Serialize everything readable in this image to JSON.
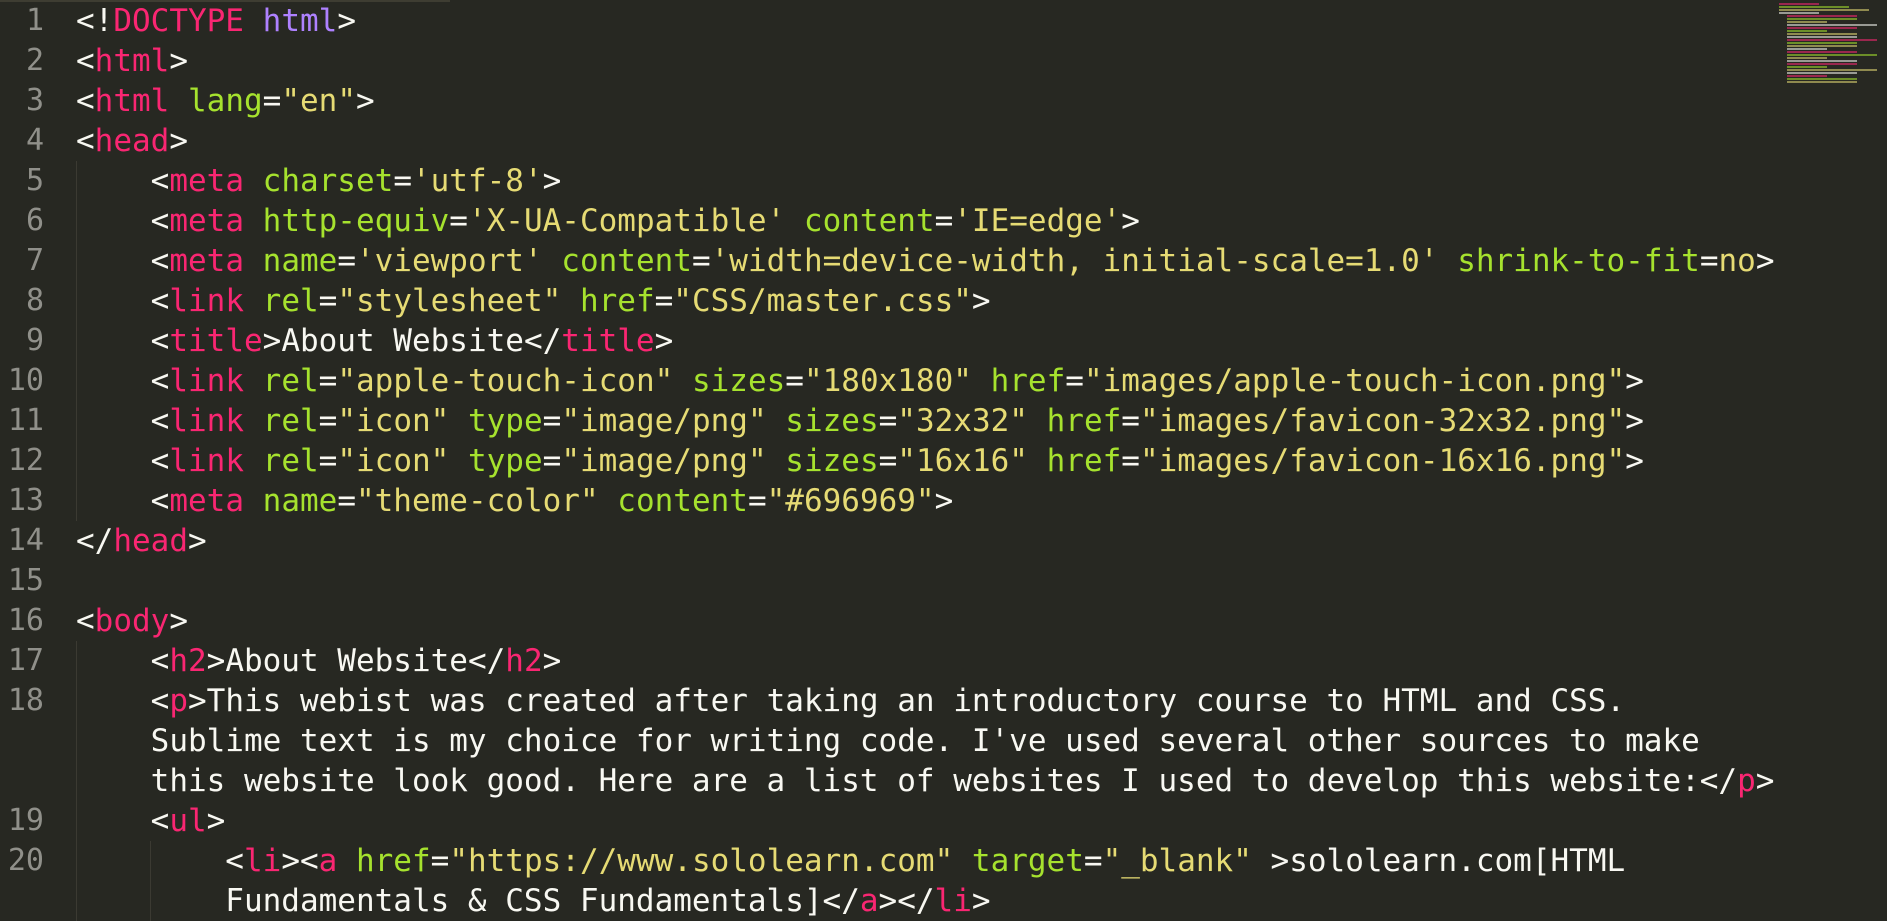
{
  "editor": {
    "theme_colors": {
      "background": "#272822",
      "tag": "#f92672",
      "attribute": "#a6e22e",
      "string": "#e6db74",
      "doctype": "#ae81ff",
      "text": "#f8f8f2",
      "line_number": "#90908a"
    },
    "line_numbers": [
      "1",
      "2",
      "3",
      "4",
      "5",
      "6",
      "7",
      "8",
      "9",
      "10",
      "11",
      "12",
      "13",
      "14",
      "15",
      "16",
      "17",
      "18",
      "19",
      "20"
    ],
    "lines": [
      {
        "segments": [
          {
            "t": "<!",
            "c": "pl"
          },
          {
            "t": "DOCTYPE",
            "c": "tg"
          },
          {
            "t": " ",
            "c": "pl"
          },
          {
            "t": "html",
            "c": "dt"
          },
          {
            "t": ">",
            "c": "pl"
          }
        ]
      },
      {
        "segments": [
          {
            "t": "<",
            "c": "pl"
          },
          {
            "t": "html",
            "c": "tg"
          },
          {
            "t": ">",
            "c": "pl"
          }
        ]
      },
      {
        "segments": [
          {
            "t": "<",
            "c": "pl"
          },
          {
            "t": "html",
            "c": "tg"
          },
          {
            "t": " ",
            "c": "pl"
          },
          {
            "t": "lang",
            "c": "an"
          },
          {
            "t": "=",
            "c": "pl"
          },
          {
            "t": "\"en\"",
            "c": "sv"
          },
          {
            "t": ">",
            "c": "pl"
          }
        ]
      },
      {
        "segments": [
          {
            "t": "<",
            "c": "pl"
          },
          {
            "t": "head",
            "c": "tg"
          },
          {
            "t": ">",
            "c": "pl"
          }
        ]
      },
      {
        "segments": [
          {
            "t": "    <",
            "c": "pl"
          },
          {
            "t": "meta",
            "c": "tg"
          },
          {
            "t": " ",
            "c": "pl"
          },
          {
            "t": "charset",
            "c": "an"
          },
          {
            "t": "=",
            "c": "pl"
          },
          {
            "t": "'utf-8'",
            "c": "sv"
          },
          {
            "t": ">",
            "c": "pl"
          }
        ]
      },
      {
        "segments": [
          {
            "t": "    <",
            "c": "pl"
          },
          {
            "t": "meta",
            "c": "tg"
          },
          {
            "t": " ",
            "c": "pl"
          },
          {
            "t": "http-equiv",
            "c": "an"
          },
          {
            "t": "=",
            "c": "pl"
          },
          {
            "t": "'X-UA-Compatible'",
            "c": "sv"
          },
          {
            "t": " ",
            "c": "pl"
          },
          {
            "t": "content",
            "c": "an"
          },
          {
            "t": "=",
            "c": "pl"
          },
          {
            "t": "'IE=edge'",
            "c": "sv"
          },
          {
            "t": ">",
            "c": "pl"
          }
        ]
      },
      {
        "segments": [
          {
            "t": "    <",
            "c": "pl"
          },
          {
            "t": "meta",
            "c": "tg"
          },
          {
            "t": " ",
            "c": "pl"
          },
          {
            "t": "name",
            "c": "an"
          },
          {
            "t": "=",
            "c": "pl"
          },
          {
            "t": "'viewport'",
            "c": "sv"
          },
          {
            "t": " ",
            "c": "pl"
          },
          {
            "t": "content",
            "c": "an"
          },
          {
            "t": "=",
            "c": "pl"
          },
          {
            "t": "'width=device-width, initial-scale=1.0'",
            "c": "sv"
          },
          {
            "t": " ",
            "c": "pl"
          },
          {
            "t": "shrink-to-fit",
            "c": "an"
          },
          {
            "t": "=",
            "c": "pl"
          },
          {
            "t": "no",
            "c": "sv"
          },
          {
            "t": ">",
            "c": "pl"
          }
        ]
      },
      {
        "segments": [
          {
            "t": "    <",
            "c": "pl"
          },
          {
            "t": "link",
            "c": "tg"
          },
          {
            "t": " ",
            "c": "pl"
          },
          {
            "t": "rel",
            "c": "an"
          },
          {
            "t": "=",
            "c": "pl"
          },
          {
            "t": "\"stylesheet\"",
            "c": "sv"
          },
          {
            "t": " ",
            "c": "pl"
          },
          {
            "t": "href",
            "c": "an"
          },
          {
            "t": "=",
            "c": "pl"
          },
          {
            "t": "\"CSS/master.css\"",
            "c": "sv"
          },
          {
            "t": ">",
            "c": "pl"
          }
        ]
      },
      {
        "segments": [
          {
            "t": "    <",
            "c": "pl"
          },
          {
            "t": "title",
            "c": "tg"
          },
          {
            "t": ">About Website</",
            "c": "pl"
          },
          {
            "t": "title",
            "c": "tg"
          },
          {
            "t": ">",
            "c": "pl"
          }
        ]
      },
      {
        "segments": [
          {
            "t": "    <",
            "c": "pl"
          },
          {
            "t": "link",
            "c": "tg"
          },
          {
            "t": " ",
            "c": "pl"
          },
          {
            "t": "rel",
            "c": "an"
          },
          {
            "t": "=",
            "c": "pl"
          },
          {
            "t": "\"apple-touch-icon\"",
            "c": "sv"
          },
          {
            "t": " ",
            "c": "pl"
          },
          {
            "t": "sizes",
            "c": "an"
          },
          {
            "t": "=",
            "c": "pl"
          },
          {
            "t": "\"180x180\"",
            "c": "sv"
          },
          {
            "t": " ",
            "c": "pl"
          },
          {
            "t": "href",
            "c": "an"
          },
          {
            "t": "=",
            "c": "pl"
          },
          {
            "t": "\"images/apple-touch-icon.png\"",
            "c": "sv"
          },
          {
            "t": ">",
            "c": "pl"
          }
        ]
      },
      {
        "segments": [
          {
            "t": "    <",
            "c": "pl"
          },
          {
            "t": "link",
            "c": "tg"
          },
          {
            "t": " ",
            "c": "pl"
          },
          {
            "t": "rel",
            "c": "an"
          },
          {
            "t": "=",
            "c": "pl"
          },
          {
            "t": "\"icon\"",
            "c": "sv"
          },
          {
            "t": " ",
            "c": "pl"
          },
          {
            "t": "type",
            "c": "an"
          },
          {
            "t": "=",
            "c": "pl"
          },
          {
            "t": "\"image/png\"",
            "c": "sv"
          },
          {
            "t": " ",
            "c": "pl"
          },
          {
            "t": "sizes",
            "c": "an"
          },
          {
            "t": "=",
            "c": "pl"
          },
          {
            "t": "\"32x32\"",
            "c": "sv"
          },
          {
            "t": " ",
            "c": "pl"
          },
          {
            "t": "href",
            "c": "an"
          },
          {
            "t": "=",
            "c": "pl"
          },
          {
            "t": "\"images/favicon-32x32.png\"",
            "c": "sv"
          },
          {
            "t": ">",
            "c": "pl"
          }
        ]
      },
      {
        "segments": [
          {
            "t": "    <",
            "c": "pl"
          },
          {
            "t": "link",
            "c": "tg"
          },
          {
            "t": " ",
            "c": "pl"
          },
          {
            "t": "rel",
            "c": "an"
          },
          {
            "t": "=",
            "c": "pl"
          },
          {
            "t": "\"icon\"",
            "c": "sv"
          },
          {
            "t": " ",
            "c": "pl"
          },
          {
            "t": "type",
            "c": "an"
          },
          {
            "t": "=",
            "c": "pl"
          },
          {
            "t": "\"image/png\"",
            "c": "sv"
          },
          {
            "t": " ",
            "c": "pl"
          },
          {
            "t": "sizes",
            "c": "an"
          },
          {
            "t": "=",
            "c": "pl"
          },
          {
            "t": "\"16x16\"",
            "c": "sv"
          },
          {
            "t": " ",
            "c": "pl"
          },
          {
            "t": "href",
            "c": "an"
          },
          {
            "t": "=",
            "c": "pl"
          },
          {
            "t": "\"images/favicon-16x16.png\"",
            "c": "sv"
          },
          {
            "t": ">",
            "c": "pl"
          }
        ]
      },
      {
        "segments": [
          {
            "t": "    <",
            "c": "pl"
          },
          {
            "t": "meta",
            "c": "tg"
          },
          {
            "t": " ",
            "c": "pl"
          },
          {
            "t": "name",
            "c": "an"
          },
          {
            "t": "=",
            "c": "pl"
          },
          {
            "t": "\"theme-color\"",
            "c": "sv"
          },
          {
            "t": " ",
            "c": "pl"
          },
          {
            "t": "content",
            "c": "an"
          },
          {
            "t": "=",
            "c": "pl"
          },
          {
            "t": "\"#696969\"",
            "c": "sv"
          },
          {
            "t": ">",
            "c": "pl"
          }
        ]
      },
      {
        "segments": [
          {
            "t": "</",
            "c": "pl"
          },
          {
            "t": "head",
            "c": "tg"
          },
          {
            "t": ">",
            "c": "pl"
          }
        ]
      },
      {
        "segments": []
      },
      {
        "segments": [
          {
            "t": "<",
            "c": "pl"
          },
          {
            "t": "body",
            "c": "tg"
          },
          {
            "t": ">",
            "c": "pl"
          }
        ]
      },
      {
        "segments": [
          {
            "t": "    <",
            "c": "pl"
          },
          {
            "t": "h2",
            "c": "tg"
          },
          {
            "t": ">About Website</",
            "c": "pl"
          },
          {
            "t": "h2",
            "c": "tg"
          },
          {
            "t": ">",
            "c": "pl"
          }
        ]
      },
      {
        "segments": [
          {
            "t": "    <",
            "c": "pl"
          },
          {
            "t": "p",
            "c": "tg"
          },
          {
            "t": ">This webist was created after taking an introductory course to HTML and CSS.",
            "c": "pl"
          }
        ]
      },
      {
        "segments": [
          {
            "t": "    Sublime text is my choice for writing code. I've used several other sources to make",
            "c": "pl"
          }
        ]
      },
      {
        "segments": [
          {
            "t": "    this website look good. Here are a list of websites I used to develop this website:</",
            "c": "pl"
          },
          {
            "t": "p",
            "c": "tg"
          },
          {
            "t": ">",
            "c": "pl"
          }
        ]
      },
      {
        "segments": [
          {
            "t": "    <",
            "c": "pl"
          },
          {
            "t": "ul",
            "c": "tg"
          },
          {
            "t": ">",
            "c": "pl"
          }
        ]
      },
      {
        "segments": [
          {
            "t": "        <",
            "c": "pl"
          },
          {
            "t": "li",
            "c": "tg"
          },
          {
            "t": "><",
            "c": "pl"
          },
          {
            "t": "a",
            "c": "tg"
          },
          {
            "t": " ",
            "c": "pl"
          },
          {
            "t": "href",
            "c": "an"
          },
          {
            "t": "=",
            "c": "pl"
          },
          {
            "t": "\"https://www.sololearn.com\"",
            "c": "sv"
          },
          {
            "t": " ",
            "c": "pl"
          },
          {
            "t": "target",
            "c": "an"
          },
          {
            "t": "=",
            "c": "pl"
          },
          {
            "t": "\"_blank\"",
            "c": "sv"
          },
          {
            "t": " >sololearn.com[HTML",
            "c": "pl"
          }
        ]
      },
      {
        "segments": [
          {
            "t": "        Fundamentals & CSS Fundamentals]</",
            "c": "pl"
          },
          {
            "t": "a",
            "c": "tg"
          },
          {
            "t": "></",
            "c": "pl"
          },
          {
            "t": "li",
            "c": "tg"
          },
          {
            "t": ">",
            "c": "pl"
          }
        ]
      }
    ],
    "line_number_rows": [
      0,
      1,
      2,
      3,
      4,
      5,
      6,
      7,
      8,
      9,
      10,
      11,
      12,
      13,
      14,
      15,
      16,
      17,
      20,
      21
    ]
  }
}
